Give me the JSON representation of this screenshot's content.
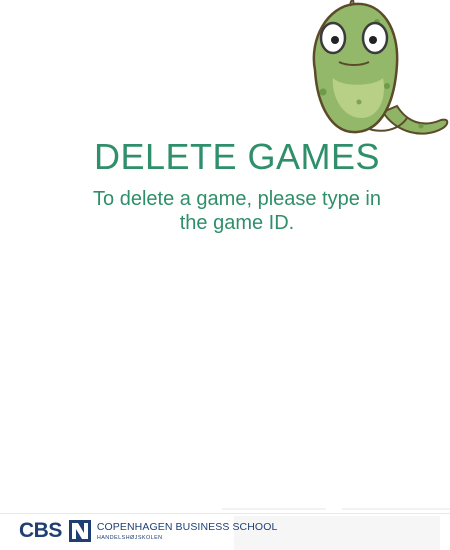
{
  "theme": {
    "accent": "#2f8f6b",
    "brand_navy": "#1f3f73"
  },
  "main": {
    "title": "DELETE GAMES",
    "instructions_line1": "To delete a game, please type in",
    "instructions_line2": "the game ID."
  },
  "mascot": {
    "icon": "snake-mascot-icon"
  },
  "footer": {
    "logo_abbr": "CBS",
    "logo_name": "COPENHAGEN BUSINESS SCHOOL",
    "logo_sub": "HANDELSHØJSKOLEN",
    "logo_icon": "cbs-logo-mark-icon"
  }
}
